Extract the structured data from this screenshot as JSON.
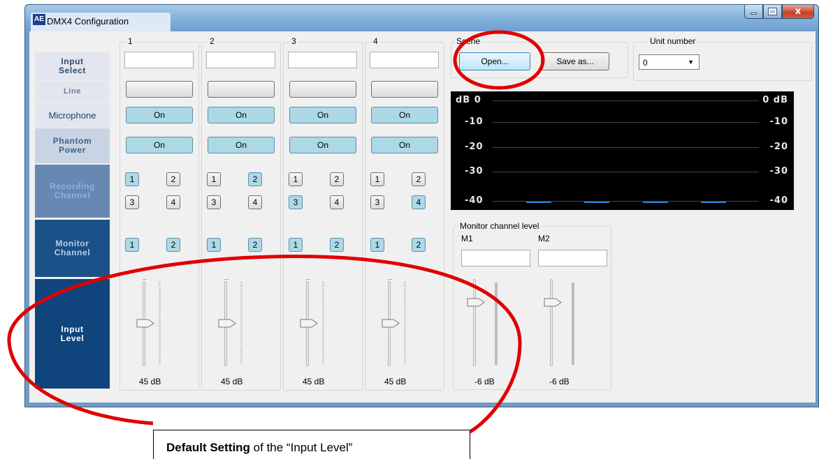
{
  "window": {
    "title": "DMX4 Configuration",
    "logo": "AE",
    "close_glyph": "x"
  },
  "row_labels": {
    "input_select": "Input\nSelect",
    "line": "Line",
    "microphone": "Microphone",
    "phantom_power": "Phantom\nPower",
    "recording_channel": "Recording\nChannel",
    "monitor_channel": "Monitor\nChannel",
    "input_level": "Input\nLevel"
  },
  "channels": [
    {
      "number": "1",
      "microphone": "On",
      "phantom": "On",
      "rec": [
        "1",
        "2",
        "3",
        "4"
      ],
      "rec_on": [
        true,
        false,
        false,
        false
      ],
      "mon": [
        "1",
        "2"
      ],
      "mon_on": [
        true,
        true
      ],
      "level": "45 dB",
      "level_value_db": 45
    },
    {
      "number": "2",
      "microphone": "On",
      "phantom": "On",
      "rec": [
        "1",
        "2",
        "3",
        "4"
      ],
      "rec_on": [
        false,
        true,
        false,
        false
      ],
      "mon": [
        "1",
        "2"
      ],
      "mon_on": [
        true,
        true
      ],
      "level": "45 dB",
      "level_value_db": 45
    },
    {
      "number": "3",
      "microphone": "On",
      "phantom": "On",
      "rec": [
        "1",
        "2",
        "3",
        "4"
      ],
      "rec_on": [
        false,
        false,
        true,
        false
      ],
      "mon": [
        "1",
        "2"
      ],
      "mon_on": [
        true,
        true
      ],
      "level": "45 dB",
      "level_value_db": 45
    },
    {
      "number": "4",
      "microphone": "On",
      "phantom": "On",
      "rec": [
        "1",
        "2",
        "3",
        "4"
      ],
      "rec_on": [
        false,
        false,
        false,
        true
      ],
      "mon": [
        "1",
        "2"
      ],
      "mon_on": [
        true,
        true
      ],
      "level": "45 dB",
      "level_value_db": 45
    }
  ],
  "scene": {
    "title": "Scene",
    "open": "Open...",
    "save_as": "Save as..."
  },
  "unit": {
    "title": "Unit number",
    "value": "0"
  },
  "level_meter": {
    "left_labels": [
      "dB  0",
      "-10",
      "-20",
      "-30",
      "-40"
    ],
    "right_labels": [
      "0  dB",
      "-10",
      "-20",
      "-30",
      "-40"
    ]
  },
  "monitor_level": {
    "title": "Monitor channel level",
    "channels": [
      {
        "label": "M1",
        "level": "-6 dB"
      },
      {
        "label": "M2",
        "level": "-6 dB"
      }
    ]
  },
  "annotation": {
    "bold": "Default Setting",
    "rest": " of the “Input Level”"
  },
  "colors": {
    "highlight_circle": "#e00000",
    "button_on": "#add8e6",
    "label_pale": "#8aa8c8",
    "label_dark": "#114a80",
    "meter_bar": "#2f7fd0"
  }
}
